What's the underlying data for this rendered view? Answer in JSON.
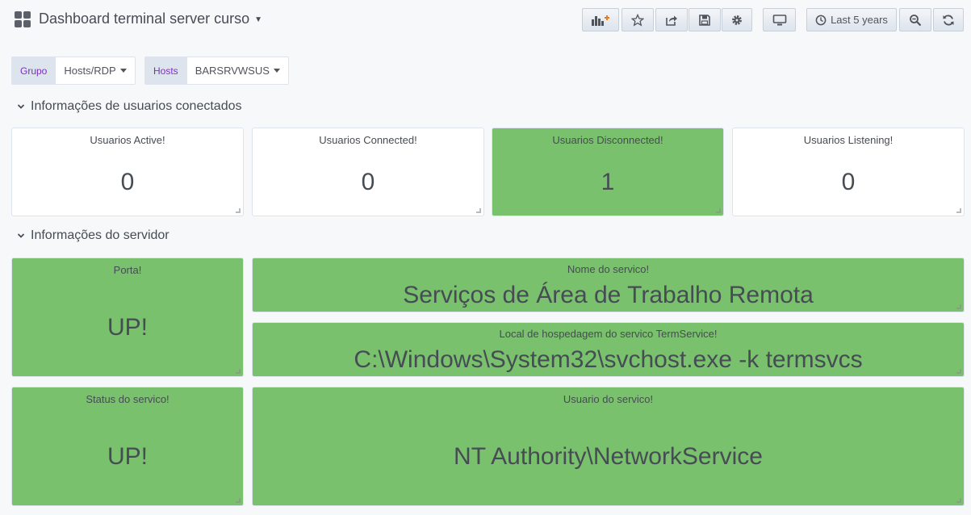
{
  "header": {
    "title": "Dashboard terminal server curso",
    "time_range": "Last 5 years",
    "icons": [
      "add-panel-icon",
      "star-icon",
      "share-icon",
      "save-icon",
      "gear-icon",
      "monitor-icon",
      "clock-icon",
      "zoom-out-icon",
      "refresh-icon"
    ]
  },
  "variables": [
    {
      "label": "Grupo",
      "value": "Hosts/RDP"
    },
    {
      "label": "Hosts",
      "value": "BARSRVWSUS"
    }
  ],
  "rows": [
    {
      "title": "Informações de usuarios conectados"
    },
    {
      "title": "Informações do servidor"
    }
  ],
  "panels": {
    "active": {
      "title": "Usuarios Active!",
      "value": "0"
    },
    "connected": {
      "title": "Usuarios Connected!",
      "value": "0"
    },
    "disconnected": {
      "title": "Usuarios Disconnected!",
      "value": "1"
    },
    "listening": {
      "title": "Usuarios Listening!",
      "value": "0"
    },
    "porta": {
      "title": "Porta!",
      "value": "UP!"
    },
    "nome": {
      "title": "Nome do servico!",
      "value": "Serviços de Área de Trabalho Remota"
    },
    "local": {
      "title": "Local de hospedagem do servico TermService!",
      "value": "C:\\Windows\\System32\\svchost.exe -k termsvcs"
    },
    "status": {
      "title": "Status do servico!",
      "value": "UP!"
    },
    "usuario": {
      "title": "Usuario do servico!",
      "value": "NT Authority\\NetworkService"
    }
  },
  "colors": {
    "green_threshold": "#79c16c",
    "text": "#464c54",
    "variable_label": "#7b2fbf"
  }
}
